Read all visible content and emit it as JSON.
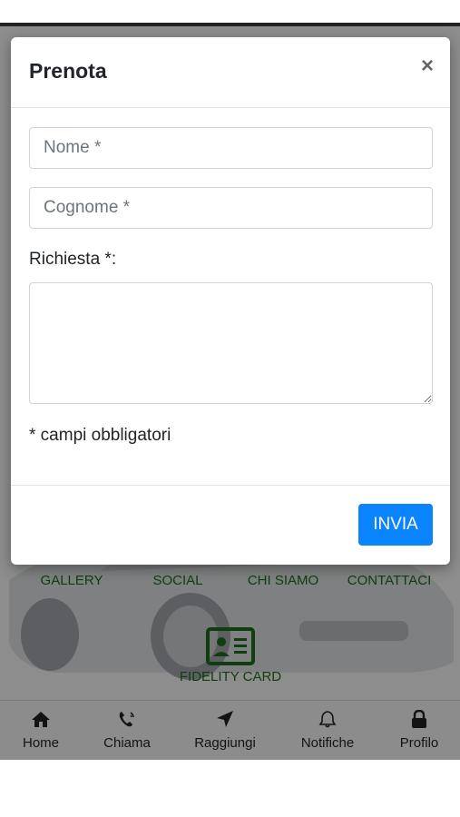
{
  "modal": {
    "title": "Prenota",
    "close_symbol": "×",
    "name_placeholder": "Nome *",
    "surname_placeholder": "Cognome *",
    "request_label": "Richiesta *:",
    "required_note": "* campi obbligatori",
    "submit_label": "INVIA"
  },
  "menu": {
    "items": [
      {
        "label": "GALLERY"
      },
      {
        "label": "SOCIAL"
      },
      {
        "label": "CHI SIAMO"
      },
      {
        "label": "CONTATTACI"
      }
    ],
    "fidelity_label": "FIDELITY CARD",
    "fidelity_icon": "id-card-icon",
    "accent_color": "#1d6b1d"
  },
  "tabbar": {
    "items": [
      {
        "label": "Home",
        "icon": "home-icon"
      },
      {
        "label": "Chiama",
        "icon": "phone-icon"
      },
      {
        "label": "Raggiungi",
        "icon": "location-arrow-icon"
      },
      {
        "label": "Notifiche",
        "icon": "bell-icon"
      },
      {
        "label": "Profilo",
        "icon": "lock-icon"
      }
    ]
  },
  "colors": {
    "primary_button": "#0a84ff"
  }
}
